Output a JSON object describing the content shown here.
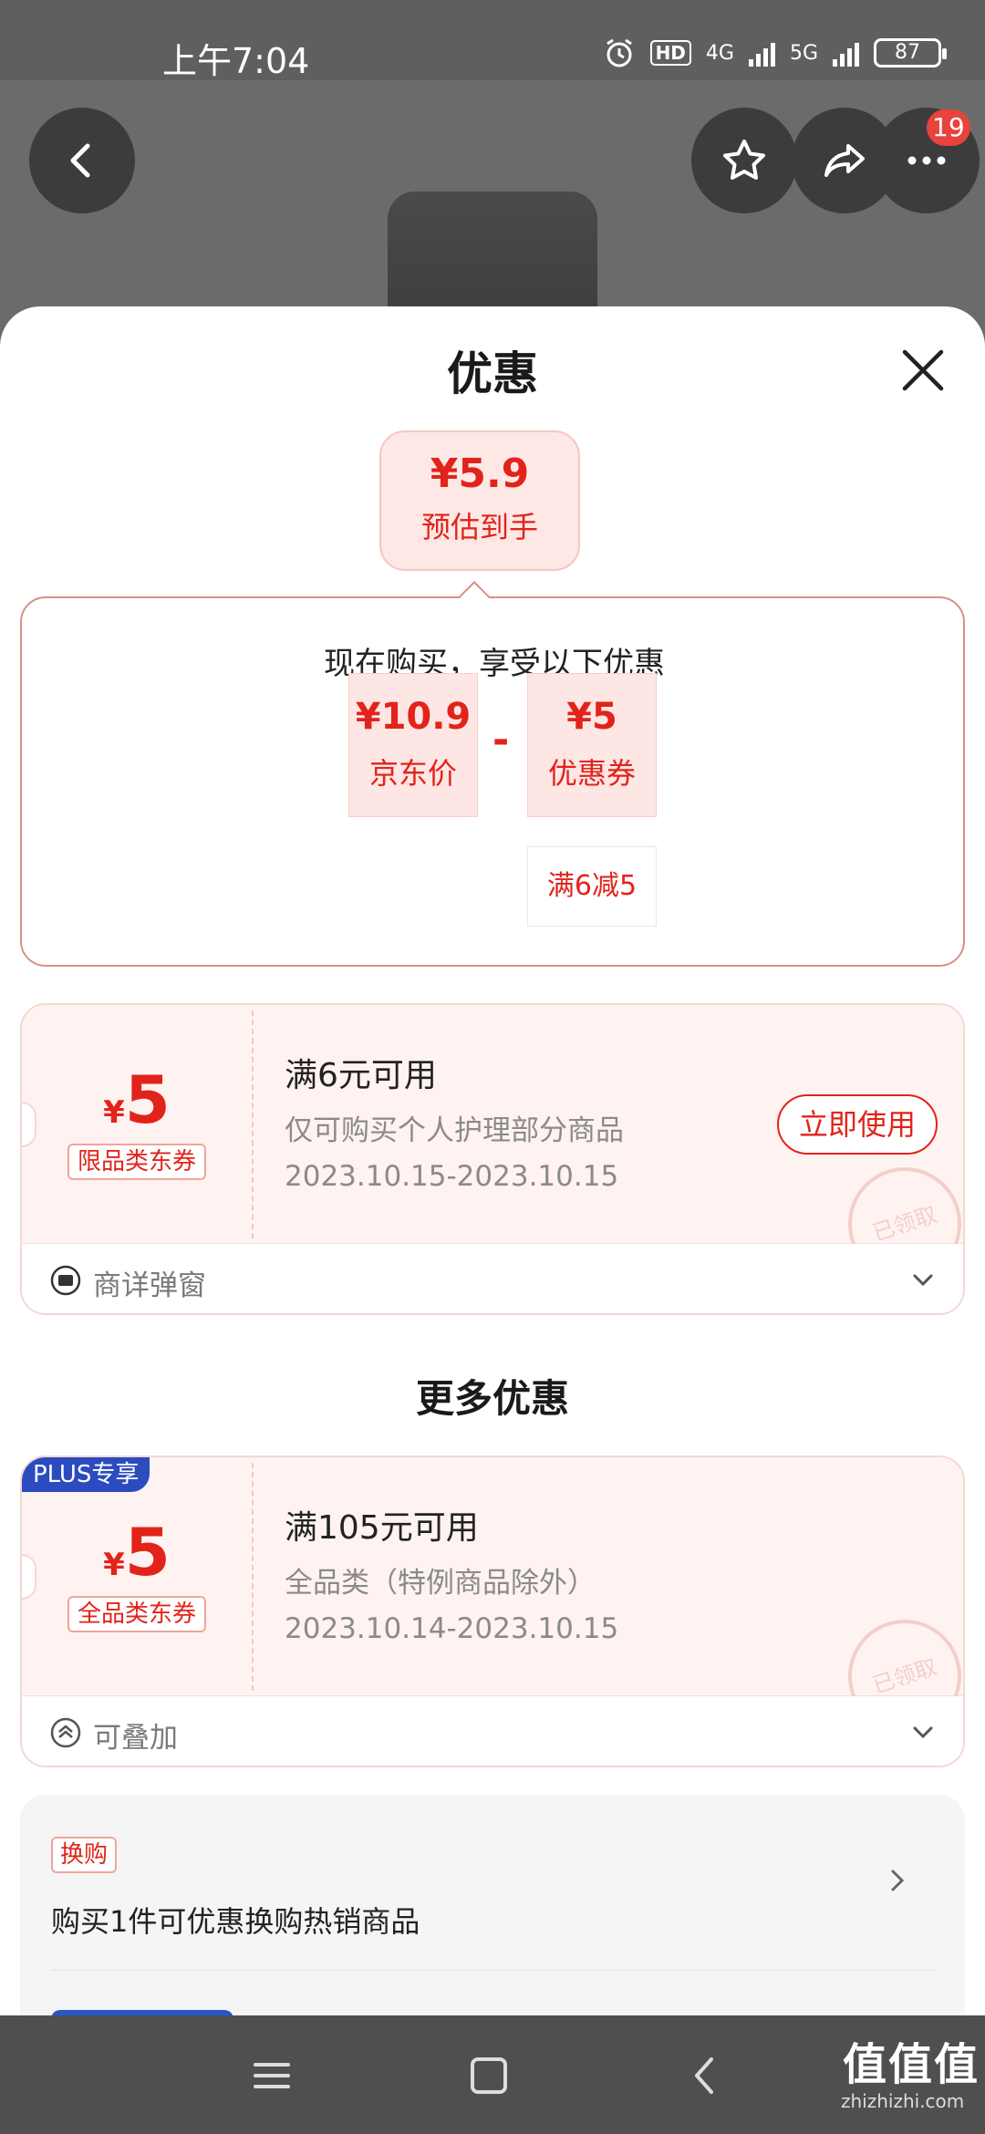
{
  "status_bar": {
    "time": "上午7:04",
    "hd": "HD",
    "net1": "4G",
    "net2": "5G",
    "battery": "87"
  },
  "top_actions": {
    "badge_count": "19"
  },
  "sheet": {
    "title": "优惠",
    "estimate": {
      "price": "¥5.9",
      "label": "预估到手"
    },
    "summary": {
      "text": "现在购买，享受以下优惠",
      "jd_price": {
        "value": "¥10.9",
        "label": "京东价"
      },
      "minus": "-",
      "coupon": {
        "value": "¥5",
        "label": "优惠券",
        "condition": "满6减5"
      }
    },
    "coupons": [
      {
        "currency": "¥",
        "amount": "5",
        "tag": "限品类东券",
        "title": "满6元可用",
        "scope": "仅可购买个人护理部分商品",
        "date": "2023.10.15-2023.10.15",
        "button": "立即使用",
        "stamp": "已领取",
        "footer": "商详弹窗"
      }
    ],
    "more_title": "更多优惠",
    "more_coupons": [
      {
        "plus_tag": "PLUS专享",
        "currency": "¥",
        "amount": "5",
        "tag": "全品类东券",
        "title": "满105元可用",
        "scope": "全品类（特例商品除外）",
        "date": "2023.10.14-2023.10.15",
        "stamp": "已领取",
        "footer": "可叠加"
      }
    ],
    "swap": {
      "tag": "换购",
      "text": "购买1件可优惠换购热销商品"
    }
  },
  "watermark": {
    "text": "值值值",
    "sub": "zhizhizhi.com"
  },
  "colors": {
    "accent": "#e2231a",
    "plus": "#2b4bbf"
  }
}
